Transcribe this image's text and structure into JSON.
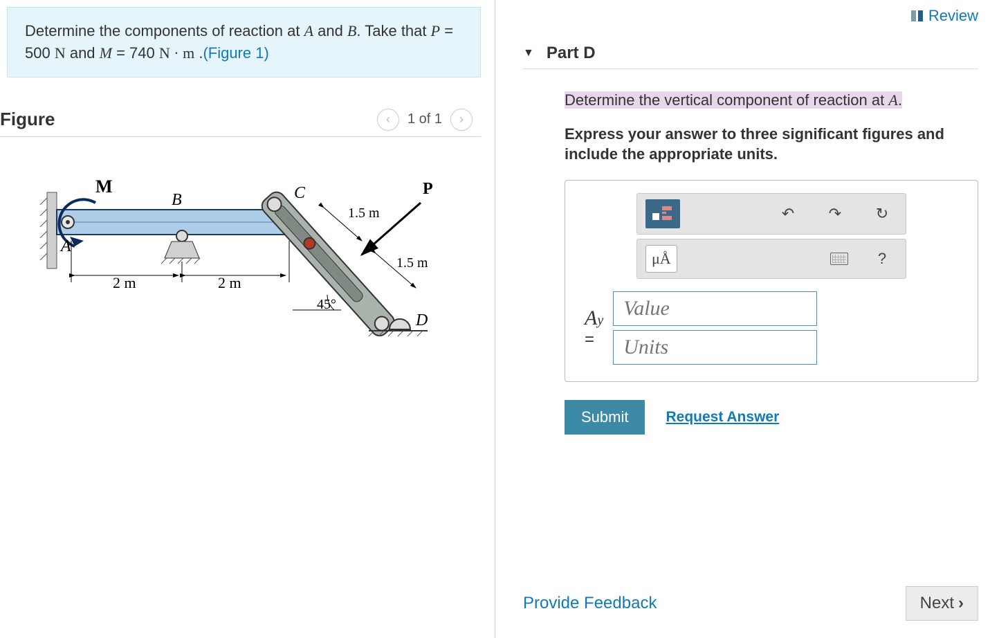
{
  "problem": {
    "intro_p1": "Determine the components of reaction at ",
    "var_A": "A",
    "p2": " and ",
    "var_B": "B",
    "p3": ". Take that ",
    "var_P": "P",
    "eq1": " = 500 ",
    "unit_N": "N",
    "p4": " and ",
    "var_M": "M",
    "eq2": " = 740 ",
    "unit_Nm": "N · m",
    "p5": " .",
    "figure_link": "(Figure 1)"
  },
  "figure": {
    "title": "Figure",
    "pager": "1 of 1",
    "labels": {
      "M": "M",
      "B": "B",
      "C": "C",
      "P": "P",
      "A": "A",
      "D": "D",
      "d1": "2 m",
      "d2": "2 m",
      "d3": "1.5 m",
      "d4": "1.5 m",
      "angle": "45°"
    }
  },
  "review": "Review",
  "part": {
    "label": "Part D",
    "question_p1": "Determine the vertical component of reaction at ",
    "question_var": "A",
    "question_p2": ".",
    "instruction": "Express your answer to three significant figures and include the appropriate units.",
    "mu_label": "μÅ",
    "variable_main": "A",
    "variable_sub": "y",
    "value_placeholder": "Value",
    "units_placeholder": "Units"
  },
  "buttons": {
    "submit": "Submit",
    "request": "Request Answer",
    "feedback": "Provide Feedback",
    "next": "Next"
  }
}
